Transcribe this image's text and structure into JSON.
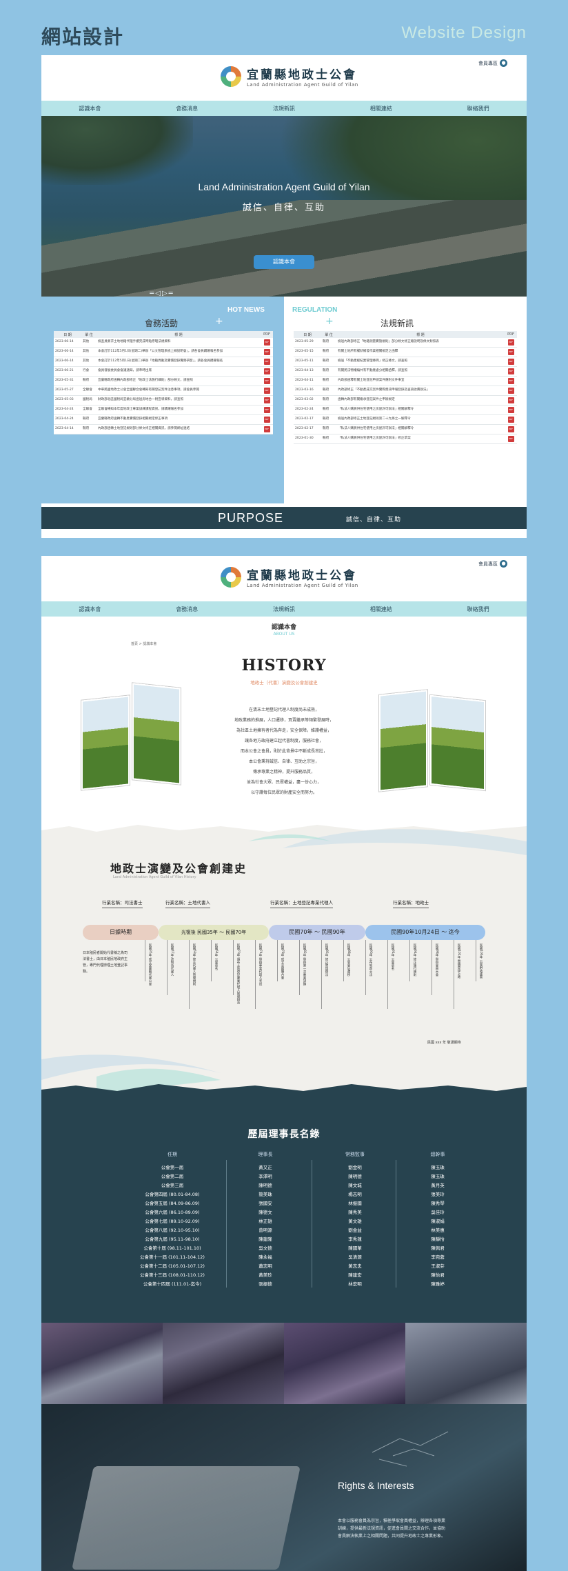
{
  "page": {
    "title_cn": "網站設計",
    "title_en": "Website Design"
  },
  "site": {
    "name_cn": "宜蘭縣地政士公會",
    "name_en": "Land Administration Agent Guild of Yilan",
    "member_label": "會員專區",
    "nav": [
      "認識本會",
      "會務消息",
      "法規新訊",
      "相關連結",
      "聯絡我們"
    ]
  },
  "hero": {
    "title": "Land Administration Agent Guild of Yilan",
    "subtitle": "誠信、自律、互助",
    "button": "認識本會"
  },
  "news": {
    "en": "HOT NEWS",
    "cn": "會務活動",
    "columns": [
      "日 期",
      "單 位",
      "標 題",
      "PDF"
    ],
    "rows": [
      {
        "date": "2023-06-14",
        "unit": "其他",
        "title": "檢查員要求土地地籍代理手續完成時點原理法規資料"
      },
      {
        "date": "2023-06-14",
        "unit": "其他",
        "title": "本會訂於112年5月1日(星期二)舉辦「公文管理系統上線說明會」，請各會員踴躍報名參加"
      },
      {
        "date": "2023-06-14",
        "unit": "其他",
        "title": "本會訂於112年5月1日(星期二)舉辦「地籍異動及實價登錄實務研習」，請各會員踴躍報名"
      },
      {
        "date": "2023-06-21",
        "unit": "行會",
        "title": "會員發展委員會會議通知，請準時出席"
      },
      {
        "date": "2023-05-31",
        "unit": "縣府",
        "title": "宜蘭縣政府函轉內政部修正「地政士法施行細則」部分條文，請查照"
      },
      {
        "date": "2023-05-27",
        "unit": "全聯會",
        "title": "中華民國地政士公會全國聯合會轉知有關登記案件注意事項，請會員參閱"
      },
      {
        "date": "2023-05-03",
        "unit": "國稅局",
        "title": "財政部北區國稅局宜蘭分局函送房地合一稅宣導資料，請查照"
      },
      {
        "date": "2023-04-24",
        "unit": "全聯會",
        "title": "全聯會轉知本年度地政士專業訓練課程資訊，請踴躍報名參加"
      },
      {
        "date": "2023-04-24",
        "unit": "縣府",
        "title": "宜蘭縣政府函轉不動產實價登錄相關規定修正事項"
      },
      {
        "date": "2023-04-14",
        "unit": "縣府",
        "title": "內政部函轉土地登記規則部分條文修正相關資訊，請參閱網址連結"
      }
    ]
  },
  "regulation": {
    "en": "REGULATION",
    "cn": "法規新訊",
    "columns": [
      "日 期",
      "單 位",
      "標 題",
      "PDF"
    ],
    "rows": [
      {
        "date": "2023-05-29",
        "unit": "縣府",
        "title": "檢送內政部修正「地籍測量實施規則」部分條文修正總說明及條文對照表"
      },
      {
        "date": "2023-05-15",
        "unit": "縣府",
        "title": "有關土地所有權狀補發作業相關規定之函釋"
      },
      {
        "date": "2023-05-11",
        "unit": "縣府",
        "title": "檢送「不動產經紀業管理條例」修正條文，請查照"
      },
      {
        "date": "2023-04-13",
        "unit": "縣府",
        "title": "有關民法物權編共有不動產處分相關函釋，請查照"
      },
      {
        "date": "2023-04-11",
        "unit": "縣府",
        "title": "內政部函釋有關土地登記申請案件應附文件事宜"
      },
      {
        "date": "2023-03-16",
        "unit": "縣府",
        "title": "內政部修正「不動產成交案件實際資訊申報登錄及查詢收費辦法」"
      },
      {
        "date": "2023-03-02",
        "unit": "縣府",
        "title": "函轉內政部有關繼承登記案件之申辦規定"
      },
      {
        "date": "2023-02-24",
        "unit": "縣府",
        "title": "「私法人購買供住宅使用之房屋許可辦法」相關解釋令"
      },
      {
        "date": "2023-02-17",
        "unit": "縣府",
        "title": "檢送內政部修正土地登記規則第二十九條之一解釋令"
      },
      {
        "date": "2023-02-17",
        "unit": "縣府",
        "title": "「私法人購買供住宅使用之房屋許可辦法」相關解釋令"
      },
      {
        "date": "2023-01-30",
        "unit": "縣府",
        "title": "「私法人購買供住宅使用之房屋許可辦法」修正草案"
      }
    ]
  },
  "purpose": {
    "en": "PURPOSE",
    "cn": "誠信、自律、互助"
  },
  "about": {
    "tag": "認識本會",
    "tag_en": "ABOUT US",
    "breadcrumb": "首頁 > 認識本會",
    "title": "HISTORY",
    "subtitle": "地政士（代書）演變及公會創建史",
    "text": [
      "在清末土地登記代理人制度尚未成熟，",
      "地政業務的推展，人口遷移，買賣繼承等頻繁發展時，",
      "為社區土地擁有者代為奔走，安全保障，維護權益，",
      "讓各地方政府建立起代書制度，服務社會，",
      "而本公會之會員，則於此背景中不斷成長茁壯，",
      "本公會秉持誠信、自律、互助之宗旨，",
      "傳承專業之精神，提升服務品質，",
      "並為社會大眾、民眾權益，盡一份心力，",
      "以守護每位民眾的財產安全而努力。"
    ]
  },
  "timeline": {
    "title": "地政士演變及公會創建史",
    "subtitle": "Land Administration Agent Guild of Yilan History",
    "labels": [
      "行業名稱：司法書士",
      "行業名稱：土地代書人",
      "行業名稱：土地登記專業代理人",
      "行業名稱：地政士"
    ],
    "periods": [
      "日據時期",
      "光復後 民國35年 ～ 民國70年",
      "民國70年 ～ 民國90年",
      "民國90年10月24日 ～ 迄今"
    ],
    "note": "日本殖民者開始代書稱之為司法書士，由日本殖民地政府主管，專門代理辦理土地登記事務。",
    "events": [
      "民國35年 成立宜蘭縣代書公會",
      "民國47年 改制為代書人",
      "民國59年 修正代書人管理規則",
      "民國64年 公會更名",
      "民國70年 頒布土地登記專業代理人管理辦法",
      "民國74年 舉辦專業代理人考試",
      "民國78年 成立全國聯合會",
      "民國82年 舉辦第一次專業訓練",
      "民國85年 修正管理辦法",
      "民國88年 公會會址遷移",
      "民國90年 公布地政士法",
      "民國91年 公會更名",
      "民國94年 修正施行細則",
      "民國98年 舉辦會員大會",
      "民國102年 實價登錄上路",
      "民國106年 公會網站建置"
    ],
    "end_note": "民國 xxx 年 敬請期待"
  },
  "chairs": {
    "title": "歷屆理事長名錄",
    "col_heads": [
      "任期",
      "理事長",
      "常務監事",
      "總幹事"
    ],
    "terms": [
      "公會第一屆",
      "公會第二屆",
      "公會第三屆",
      "公會第四屆 (80.01-84.08)",
      "公會第五屆 (84.09-86.09)",
      "公會第六屆 (86.10-89.09)",
      "公會第七屆 (89.10-92.09)",
      "公會第八屆 (92.10-95.10)",
      "公會第九屆 (95.11-98.10)",
      "公會第十屆 (98.11-101.10)",
      "公會第十一屆 (101.11-104.12)",
      "公會第十二屆 (105.01-107.12)",
      "公會第十三屆 (108.01-110.12)",
      "公會第十四屆 (111.01-迄今)"
    ],
    "presidents": [
      "黃又正",
      "李澤明",
      "陳明德",
      "簡美珠",
      "張國安",
      "陳德文",
      "林正雄",
      "曾明源",
      "陳建隆",
      "吳文德",
      "陳永福",
      "蕭志明",
      "黃美珍",
      "張振德"
    ],
    "supervisors": [
      "劉金明",
      "陳明德",
      "陳文城",
      "楊志明",
      "林振國",
      "陳秀美",
      "黃文雄",
      "劉金益",
      "李秀蓮",
      "陳國華",
      "吳清源",
      "黃志忠",
      "陳建宏",
      "林宏明"
    ],
    "secretaries": [
      "陳玉珠",
      "陳玉珠",
      "黃月英",
      "張美玲",
      "陳秀琴",
      "吳佳玲",
      "陳淑娟",
      "林美惠",
      "陳靜怡",
      "陳佩君",
      "李宛蓉",
      "王淑芬",
      "陳怡君",
      "陳雅婷"
    ]
  },
  "rights": {
    "title": "Rights & Interests",
    "text": "本會以服務會員為宗旨，積極爭取會員權益，辦理各項專業訓練，提供最新法規資訊，促進會員間之交流合作，並協助會員解決執業上之相關問題，共同提升地政士之專業形象。"
  },
  "colors": {
    "accent": "#3a8fcf",
    "nav": "#b6e4e8",
    "dark": "#27434f",
    "bg": "#8fc3e3"
  }
}
